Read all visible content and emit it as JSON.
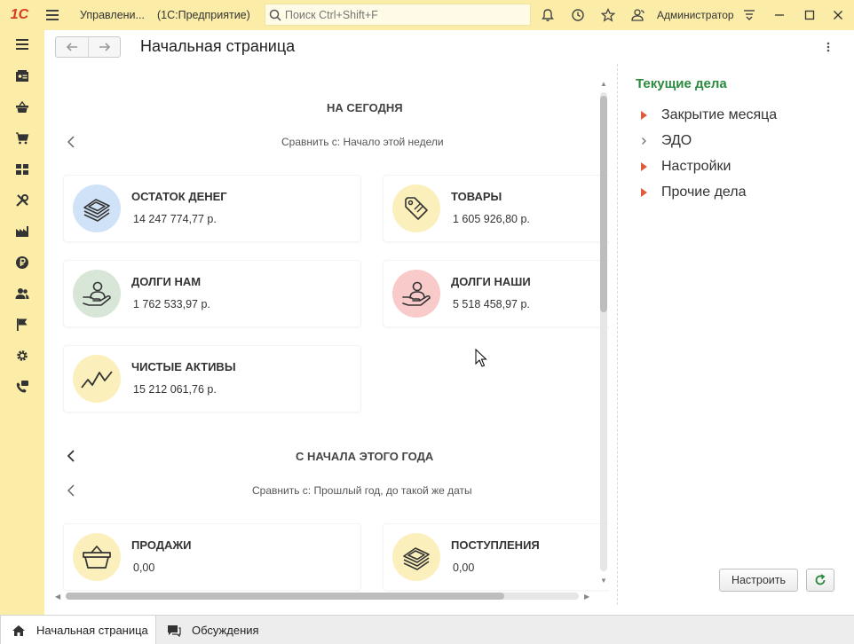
{
  "titlebar": {
    "logo_text": "1С",
    "app_title": "Управлени...",
    "app_sub": "(1С:Предприятие)",
    "search_placeholder": "Поиск Ctrl+Shift+F",
    "user_name": "Администратор"
  },
  "sidebar": {
    "items": [
      {
        "icon": "menu-icon"
      },
      {
        "icon": "contacts-icon"
      },
      {
        "icon": "basket-icon"
      },
      {
        "icon": "cart-icon"
      },
      {
        "icon": "grid-icon"
      },
      {
        "icon": "tools-icon"
      },
      {
        "icon": "factory-icon"
      },
      {
        "icon": "ruble-icon"
      },
      {
        "icon": "people-icon"
      },
      {
        "icon": "flag-icon"
      },
      {
        "icon": "gear-icon"
      },
      {
        "icon": "phone-chat-icon"
      }
    ]
  },
  "header": {
    "page_title": "Начальная страница"
  },
  "main": {
    "today": {
      "title": "НА СЕГОДНЯ",
      "compare": "Сравнить с: Начало этой недели",
      "cards": [
        {
          "title": "ОСТАТОК ДЕНЕГ",
          "value": "14 247 774,77 р.",
          "icon": "money-icon",
          "color": "#cfe2f7"
        },
        {
          "title": "ТОВАРЫ",
          "value": "1 605 926,80 р.",
          "icon": "tag-icon",
          "color": "#fbf0bb"
        },
        {
          "title": "ДОЛГИ НАМ",
          "value": "1 762 533,97 р.",
          "icon": "hand-person-icon",
          "color": "#d8e6d8"
        },
        {
          "title": "ДОЛГИ НАШИ",
          "value": "5 518 458,97 р.",
          "icon": "hand-person-icon",
          "color": "#f9caca"
        },
        {
          "title": "ЧИСТЫЕ АКТИВЫ",
          "value": "15 212 061,76 р.",
          "icon": "trend-icon",
          "color": "#fbf0bb"
        }
      ]
    },
    "year": {
      "title": "С НАЧАЛА ЭТОГО ГОДА",
      "compare": "Сравнить с: Прошлый год, до такой же даты",
      "cards": [
        {
          "title": "ПРОДАЖИ",
          "value": "0,00",
          "icon": "basket-icon",
          "color": "#fbf0bb"
        },
        {
          "title": "ПОСТУПЛЕНИЯ",
          "value": "0,00",
          "icon": "money-icon",
          "color": "#fbf0bb"
        }
      ]
    }
  },
  "right_panel": {
    "title": "Текущие дела",
    "items": [
      {
        "label": "Закрытие месяца",
        "marker": "red-triangle"
      },
      {
        "label": "ЭДО",
        "marker": "grey-chevron"
      },
      {
        "label": "Настройки",
        "marker": "red-triangle"
      },
      {
        "label": "Прочие дела",
        "marker": "red-triangle"
      }
    ],
    "setup_button": "Настроить"
  },
  "taskbar": {
    "tabs": [
      {
        "label": "Начальная страница",
        "active": true
      },
      {
        "label": "Обсуждения",
        "active": false
      }
    ]
  },
  "colors": {
    "accent_yellow": "#fbeca8",
    "green_title": "#2b8a3e",
    "red_marker": "#e05a3c"
  }
}
